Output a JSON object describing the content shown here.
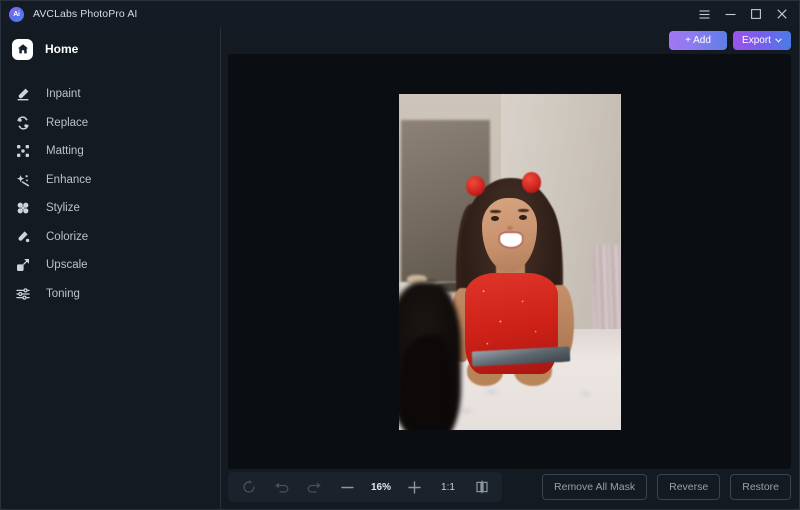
{
  "window": {
    "app_name": "AVCLabs PhotoPro AI",
    "logo_text": "Ai",
    "controls": [
      {
        "name": "menu",
        "icon": "hamburger-icon"
      },
      {
        "name": "minimize",
        "icon": "minimize-icon"
      },
      {
        "name": "maximize",
        "icon": "maximize-icon"
      },
      {
        "name": "close",
        "icon": "close-icon"
      }
    ]
  },
  "sidebar": {
    "home": {
      "label": "Home",
      "icon": "home-icon"
    },
    "items": [
      {
        "label": "Inpaint",
        "icon": "inpaint-icon"
      },
      {
        "label": "Replace",
        "icon": "replace-icon"
      },
      {
        "label": "Matting",
        "icon": "matting-icon"
      },
      {
        "label": "Enhance",
        "icon": "enhance-icon"
      },
      {
        "label": "Stylize",
        "icon": "stylize-icon"
      },
      {
        "label": "Colorize",
        "icon": "colorize-icon"
      },
      {
        "label": "Upscale",
        "icon": "upscale-icon"
      },
      {
        "label": "Toning",
        "icon": "toning-icon"
      }
    ]
  },
  "header": {
    "add_label": "+ Add",
    "export_label": "Export",
    "export_chevron": "⌄"
  },
  "canvas": {
    "image_alt": "Smiling young girl with red pom-pom hair accessories sitting on a bed holding a tablet"
  },
  "toolbar": {
    "reset_icon": "reset-icon",
    "undo_icon": "undo-icon",
    "redo_icon": "redo-icon",
    "zoom_out_label": "−",
    "zoom_level": "16%",
    "zoom_in_label": "+",
    "actual_size_label": "1:1",
    "compare_icon": "compare-view-icon",
    "remove_all_mask_label": "Remove All Mask",
    "reverse_label": "Reverse",
    "restore_label": "Restore"
  },
  "colors": {
    "sidebar_bg": "#141a22",
    "canvas_bg": "#0a0d12",
    "titlebar_bg": "#151b24",
    "accent_purple": "#8f7bf0",
    "accent_blue": "#4b7ce6",
    "text_primary": "#e4e8ee",
    "text_muted": "#96a0ad"
  }
}
